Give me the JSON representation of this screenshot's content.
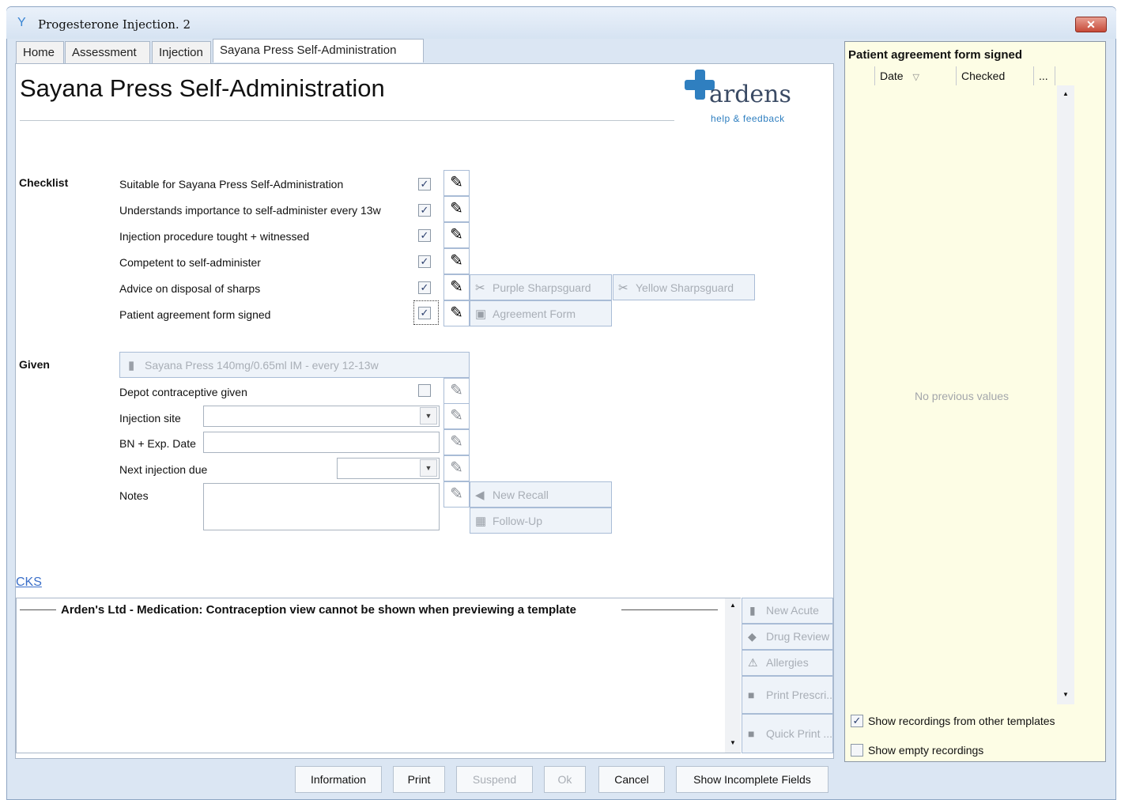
{
  "window": {
    "title": "Progesterone Injection. 2",
    "close_label": "✕"
  },
  "tabs": [
    "Home",
    "Assessment",
    "Injection",
    "Sayana Press Self-Administration"
  ],
  "page_title": "Sayana Press Self-Administration",
  "logo": {
    "name": "ardens",
    "sub": "help & feedback",
    "accent": "#2f7fc0"
  },
  "checklist": {
    "label": "Checklist",
    "items": [
      {
        "label": "Suitable for Sayana Press Self-Administration",
        "checked": true
      },
      {
        "label": "Understands importance to self-administer every 13w",
        "checked": true
      },
      {
        "label": "Injection procedure tought + witnessed",
        "checked": true
      },
      {
        "label": "Competent to self-administer",
        "checked": true
      },
      {
        "label": "Advice on disposal of sharps",
        "checked": true
      },
      {
        "label": "Patient agreement form signed",
        "checked": true
      }
    ],
    "sharps_buttons": [
      "Purple Sharpsguard",
      "Yellow Sharpsguard"
    ],
    "agreement_button": "Agreement Form"
  },
  "given": {
    "label": "Given",
    "drug_button": "Sayana Press 140mg/0.65ml IM - every 12-13w",
    "depot_label": "Depot contraceptive given",
    "injection_site_label": "Injection site",
    "bn_label": "BN + Exp. Date",
    "next_due_label": "Next injection due",
    "notes_label": "Notes",
    "new_recall": "New Recall",
    "follow_up": "Follow-Up"
  },
  "cks_link": "CKS",
  "medication_header": "Arden's Ltd - Medication: Contraception view cannot be shown when previewing a template",
  "side_buttons": [
    "New Acute",
    "Drug Review",
    "Allergies",
    "Print Prescri...",
    "Quick Print ..."
  ],
  "bottom_buttons": [
    "Information",
    "Print",
    "Suspend",
    "Ok",
    "Cancel",
    "Show Incomplete Fields"
  ],
  "right_panel": {
    "title": "Patient agreement form signed",
    "columns": [
      "Date",
      "Checked",
      "..."
    ],
    "empty_text": "No previous values",
    "show_other_templates": "Show recordings from other templates",
    "show_empty": "Show empty recordings"
  }
}
